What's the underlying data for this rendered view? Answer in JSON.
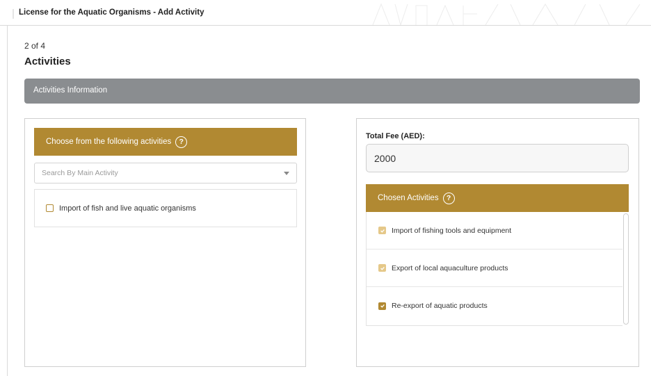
{
  "header": {
    "title": "License for the Aquatic Organisms - Add Activity"
  },
  "step": {
    "indicator": "2 of 4",
    "title": "Activities"
  },
  "info_bar": {
    "label": "Activities Information"
  },
  "left_panel": {
    "header": "Choose from the following activities",
    "help_icon": "?",
    "search_placeholder": "Search By Main Activity",
    "activities": [
      {
        "label": "Import of fish and live aquatic organisms",
        "checked": false
      }
    ]
  },
  "right_panel": {
    "fee_label": "Total Fee (AED):",
    "fee_value": "2000",
    "chosen_header": "Chosen Activities",
    "help_icon": "?",
    "chosen": [
      {
        "label": "Import of fishing tools and equipment",
        "checked": true,
        "disabled": true
      },
      {
        "label": "Export of local aquaculture products",
        "checked": true,
        "disabled": true
      },
      {
        "label": "Re-export of aquatic products",
        "checked": true,
        "disabled": false
      }
    ]
  },
  "colors": {
    "gold": "#b18932",
    "gray_bar": "#8a8d90",
    "faded_check": "#e5c889"
  }
}
